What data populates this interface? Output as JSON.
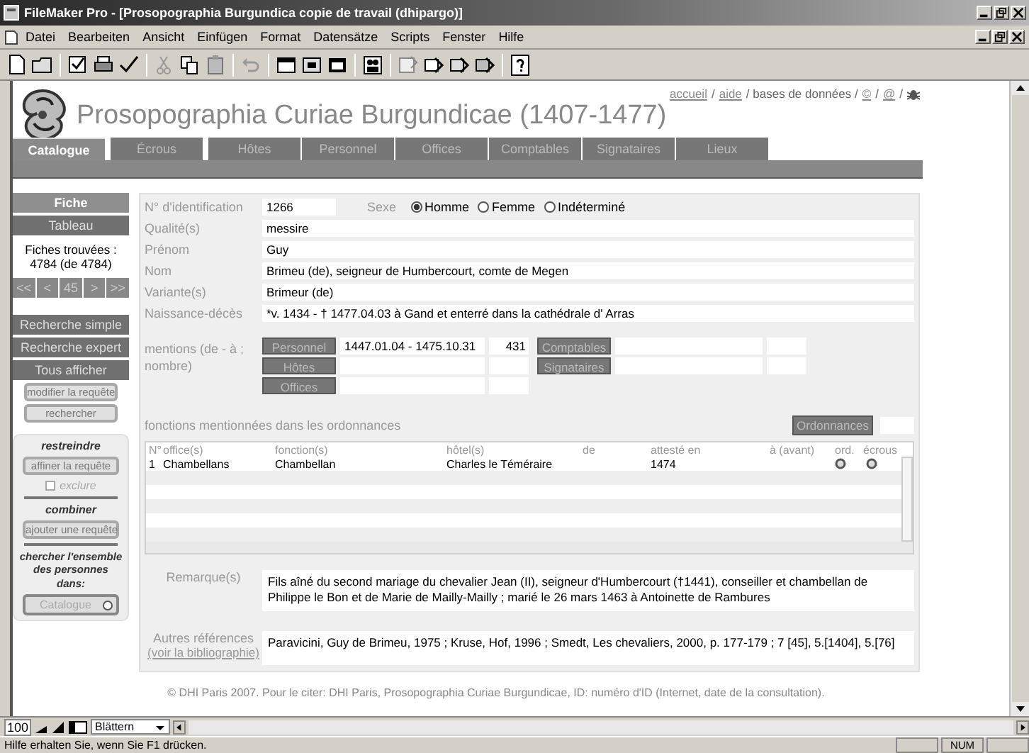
{
  "window": {
    "title": "FileMaker Pro - [Prosopographia Burgundica copie de travail (dhipargo)]"
  },
  "menu": [
    "Datei",
    "Bearbeiten",
    "Ansicht",
    "Einfügen",
    "Format",
    "Datensätze",
    "Scripts",
    "Fenster",
    "Hilfe"
  ],
  "site": {
    "title": "Prosopographia Curiae Burgundicae (1407-1477)",
    "links": [
      {
        "label": "accueil",
        "kind": "link"
      },
      {
        "label": "/",
        "kind": "sep"
      },
      {
        "label": "aide",
        "kind": "link"
      },
      {
        "label": "/ bases de données /",
        "kind": "sep"
      },
      {
        "label": "©",
        "kind": "link"
      },
      {
        "label": "/",
        "kind": "sep"
      },
      {
        "label": "@",
        "kind": "link"
      },
      {
        "label": "/",
        "kind": "sep"
      }
    ]
  },
  "tabs": [
    {
      "label": "Catalogue",
      "selected": true
    },
    {
      "label": "Écrous",
      "selected": false
    },
    {
      "label": "Hôtes",
      "selected": false
    },
    {
      "label": "Personnel",
      "selected": false
    },
    {
      "label": "Offices",
      "selected": false
    },
    {
      "label": "Comptables",
      "selected": false
    },
    {
      "label": "Signataires",
      "selected": false
    },
    {
      "label": "Lieux",
      "selected": false
    }
  ],
  "sidebar": {
    "views": [
      {
        "label": "Fiche",
        "selected": true
      },
      {
        "label": "Tableau",
        "selected": false
      }
    ],
    "found": "Fiches trouvées : 4784 (de 4784)",
    "nav": [
      "<<",
      "<",
      "45",
      ">",
      ">>"
    ],
    "actions": [
      {
        "label": "Recherche simple",
        "disabled": false
      },
      {
        "label": "Recherche expert",
        "disabled": false
      },
      {
        "label": "Tous afficher",
        "disabled": false
      },
      {
        "label": "modifier la requête",
        "disabled": true
      },
      {
        "label": "rechercher",
        "disabled": true
      }
    ],
    "box": [
      {
        "kind": "heading",
        "label": "restreindre"
      },
      {
        "kind": "button",
        "label": "affiner la requête"
      },
      {
        "kind": "checkbox",
        "label": "exclure",
        "checked": false
      },
      {
        "kind": "rule"
      },
      {
        "kind": "heading",
        "label": "combiner"
      },
      {
        "kind": "button",
        "label": "ajouter une requête"
      },
      {
        "kind": "rule"
      },
      {
        "kind": "text",
        "label": "chercher l'ensemble des personnes dans:"
      },
      {
        "kind": "dropdown",
        "label": "Catalogue"
      }
    ]
  },
  "record": {
    "id": {
      "label": "N° d'identification",
      "value": "1266"
    },
    "sexe": {
      "label": "Sexe",
      "options": [
        {
          "label": "Homme",
          "selected": true
        },
        {
          "label": "Femme",
          "selected": false
        },
        {
          "label": "Indéterminé",
          "selected": false
        }
      ]
    },
    "fields": [
      {
        "label": "Qualité(s)",
        "value": "messire"
      },
      {
        "label": "Prénom",
        "value": "Guy"
      },
      {
        "label": "Nom",
        "value": "Brimeu (de), seigneur de Humbercourt, comte de Megen"
      },
      {
        "label": "Variante(s)",
        "value": "Brimeur (de)"
      },
      {
        "label": "Naissance-décès",
        "value": "*v. 1434 - † 1477.04.03 à Gand et enterré dans la cathédrale d' Arras"
      }
    ],
    "mentions": {
      "label": "mentions (de - à ; nombre)",
      "left": [
        {
          "label": "Personnel",
          "range": "1447.01.04 - 1475.10.31",
          "count": "431"
        },
        {
          "label": "Hôtes"
        },
        {
          "label": "Offices"
        }
      ],
      "right": [
        {
          "label": "Comptables"
        },
        {
          "label": "Signataires"
        }
      ]
    },
    "fonctions": {
      "title": "fonctions mentionnées dans les ordonnances",
      "button": "Ordonnances",
      "columns": [
        "N°",
        "office(s)",
        "fonction(s)",
        "hôtel(s)",
        "de",
        "attesté en",
        "à (avant)",
        "ord.",
        "écrous"
      ],
      "rows": [
        {
          "no": "1",
          "office": "Chambellans",
          "fonction": "Chambellan",
          "hotel": "Charles le Téméraire",
          "atteste": "1474"
        }
      ]
    },
    "remarque": {
      "label": "Remarque(s)",
      "value": "Fils aîné du second mariage du chevalier Jean (II), seigneur d'Humbercourt (†1441), conseiller et chambellan de Philippe le Bon et de Marie de Mailly-Mailly ; marié le 26 mars 1463 à Antoinette de Rambures"
    },
    "references": {
      "label": "Autres références",
      "link": "(voir la bibliographie)",
      "value": "Paravicini, Guy de Brimeu, 1975 ; Kruse, Hof, 1996 ; Smedt, Les chevaliers, 2000, p. 177-179 ; 7 [45], 5.[1404], 5.[76]"
    }
  },
  "footer": "© DHI Paris 2007. Pour le citer: DHI Paris, Prosopographia Curiae Burgundicae, ID: numéro d'ID (Internet, date de la consultation).",
  "bottom": {
    "zoom": "100",
    "mode": "Blättern"
  },
  "status": {
    "text": "Hilfe erhalten Sie, wenn Sie F1 drücken.",
    "num": "NUM"
  }
}
